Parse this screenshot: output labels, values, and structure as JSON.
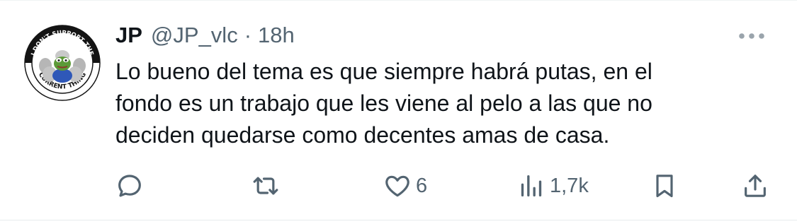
{
  "tweet": {
    "display_name": "JP",
    "handle": "@JP_vlc",
    "separator": "·",
    "time": "18h",
    "avatar": {
      "top_text": "I DON'T SUPPORT THE",
      "bottom_text": "CURRENT THING"
    },
    "text_lines": [
      "Lo bueno del tema es que siempre habrá putas, en el",
      "fondo es un trabajo que les viene al pelo a las que no",
      "deciden quedarse como decentes amas de casa."
    ]
  },
  "actions": {
    "reply": {
      "icon": "reply-icon"
    },
    "retweet": {
      "icon": "retweet-icon"
    },
    "like": {
      "icon": "heart-icon",
      "count": "6"
    },
    "views": {
      "icon": "views-icon",
      "count": "1,7k"
    },
    "bookmark": {
      "icon": "bookmark-icon"
    },
    "share": {
      "icon": "share-icon"
    }
  },
  "colors": {
    "text": "#0f1419",
    "secondary": "#536471",
    "divider": "#eff3f4"
  }
}
